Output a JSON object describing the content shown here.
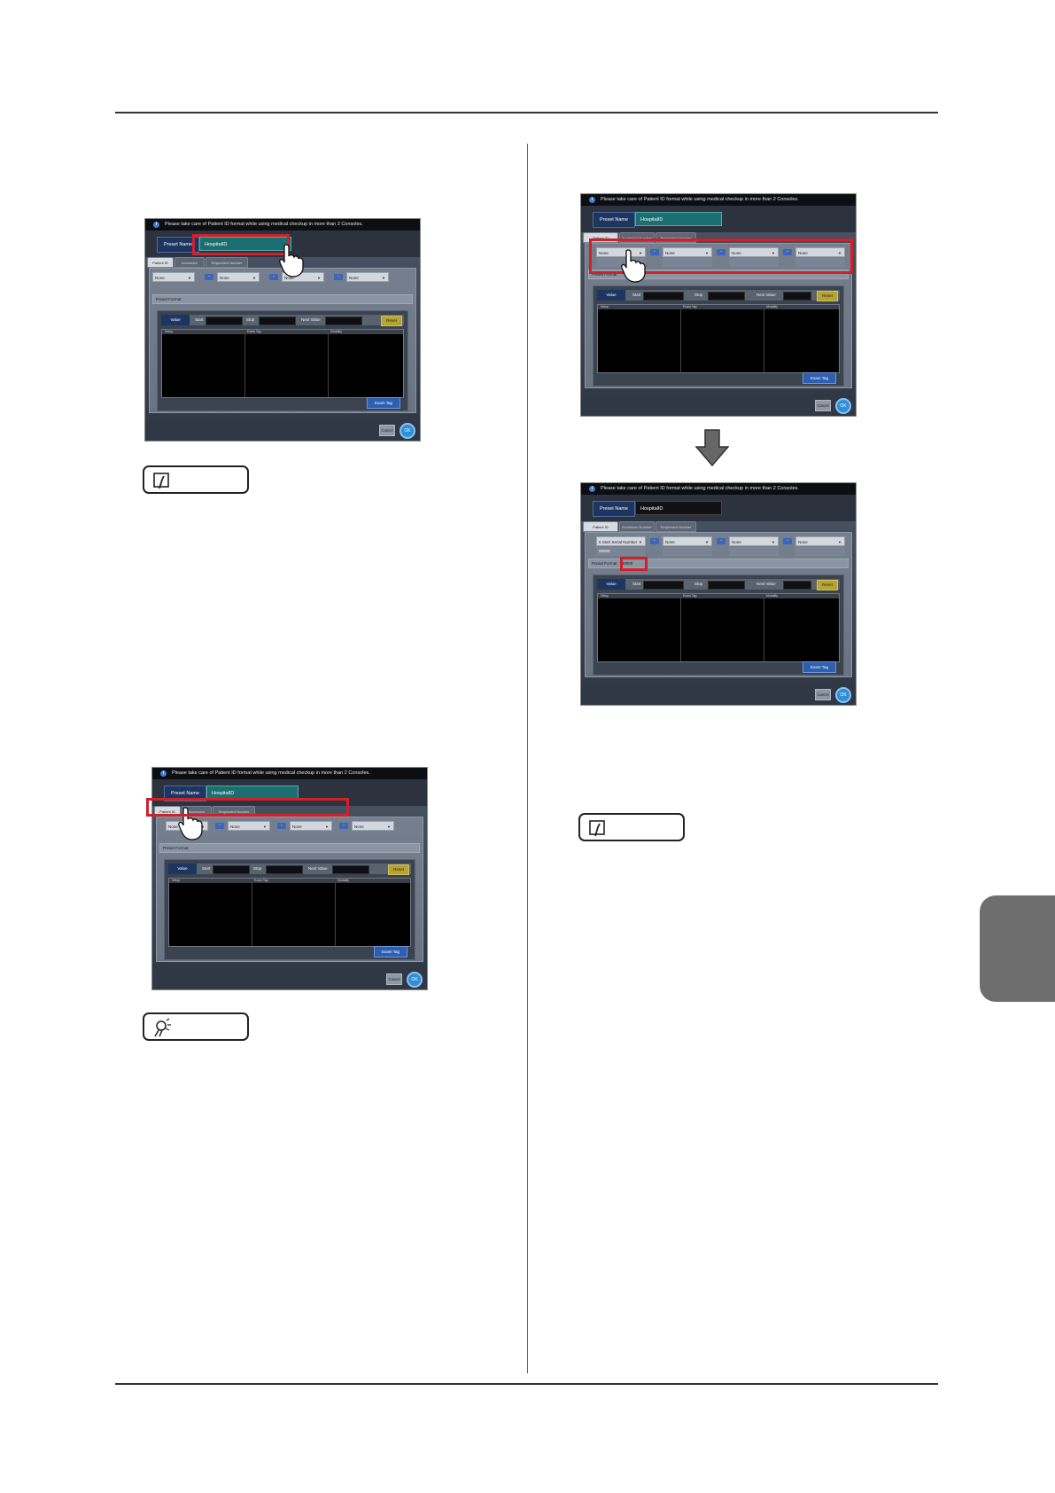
{
  "ui": {
    "notice": "Please take care of Patient ID format while using medical checkup in more than 2 Consoles.",
    "preset_name_label": "Preset Name",
    "preset_name_value": "HospitalID",
    "tabs": [
      "Patient ID",
      "Accession Number",
      "Requested Number"
    ],
    "field_default": "None",
    "field_start_serial": "5 Start Serial Number",
    "sub_value": "00000",
    "preset_format_label": "Preset Format",
    "preset_format_value": "00000",
    "value_label": "Value",
    "start_label": "Start",
    "stop_label": "Stop",
    "next_value_label": "Next Value",
    "reset_label": "Reset",
    "col_setup": "Setup",
    "col_exam_tag": "Exam Tag",
    "col_modality": "Modality",
    "exam_tag_button": "Exam Tag",
    "cancel_button": "Cancel",
    "ok_button": "OK"
  },
  "colors": {
    "highlight": "#d0202a",
    "preset_name_teal": "#1c6f70",
    "reset_yellow": "#b6a331",
    "ok_blue": "#2f8fd8",
    "chapter_tab_gray": "#6e6e6e"
  },
  "icons": [
    "info-icon",
    "pointing-hand-icon",
    "down-arrow-icon",
    "memo-icon",
    "tip-bulb-icon"
  ]
}
